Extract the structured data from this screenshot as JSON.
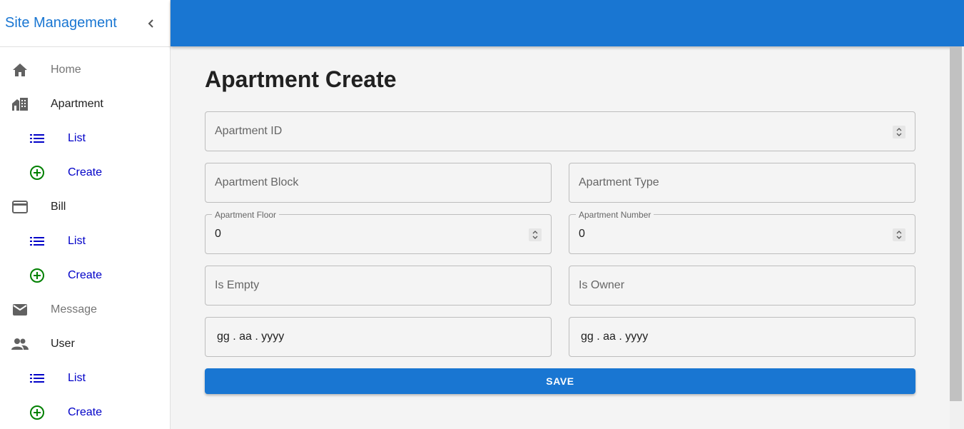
{
  "sidebar": {
    "title": "Site Management",
    "collapse_icon": "chevron-left-icon",
    "items": [
      {
        "label": "Home",
        "icon": "home-icon"
      },
      {
        "label": "Apartment",
        "icon": "apartment-icon"
      },
      {
        "label": "List",
        "icon": "list-icon"
      },
      {
        "label": "Create",
        "icon": "add-circle-icon"
      },
      {
        "label": "Bill",
        "icon": "credit-card-icon"
      },
      {
        "label": "List",
        "icon": "list-icon"
      },
      {
        "label": "Create",
        "icon": "add-circle-icon"
      },
      {
        "label": "Message",
        "icon": "mail-icon"
      },
      {
        "label": "User",
        "icon": "people-icon"
      },
      {
        "label": "List",
        "icon": "list-icon"
      },
      {
        "label": "Create",
        "icon": "add-circle-icon"
      }
    ]
  },
  "main": {
    "title": "Apartment Create",
    "fields": {
      "apartment_id": {
        "placeholder": "Apartment ID"
      },
      "apartment_block": {
        "placeholder": "Apartment Block"
      },
      "apartment_type": {
        "placeholder": "Apartment Type"
      },
      "apartment_floor": {
        "label": "Apartment Floor",
        "value": "0"
      },
      "apartment_number": {
        "label": "Apartment Number",
        "value": "0"
      },
      "is_empty": {
        "placeholder": "Is Empty"
      },
      "is_owner": {
        "placeholder": "Is Owner"
      },
      "date_1": {
        "placeholder": "gg . aa . yyyy"
      },
      "date_2": {
        "placeholder": "gg . aa . yyyy"
      }
    },
    "save_label": "SAVE"
  },
  "colors": {
    "primary": "#1976d2",
    "sub_link": "#0000c8",
    "create_icon": "#008000",
    "list_icon": "#0000c8"
  }
}
